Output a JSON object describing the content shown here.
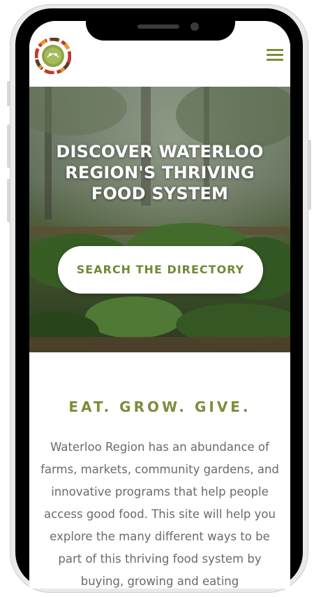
{
  "header": {
    "logo_alt": "logo",
    "menu_icon": "hamburger-menu-icon"
  },
  "hero": {
    "title_line1": "DISCOVER WATERLOO",
    "title_line2": "REGION'S THRIVING",
    "title_line3": "FOOD SYSTEM",
    "cta_label": "SEARCH THE DIRECTORY"
  },
  "section": {
    "heading": "EAT. GROW. GIVE.",
    "body": "Waterloo Region has an abundance of farms, markets, community gardens, and innovative programs that help people access good food. This site will help you explore the many different ways to be part of this thriving food system by buying, growing and eating"
  },
  "colors": {
    "accent_green": "#7d8d3a",
    "button_text_green": "#6f8a35",
    "body_text": "#6a6a6a",
    "hero_text": "#ffffff"
  }
}
